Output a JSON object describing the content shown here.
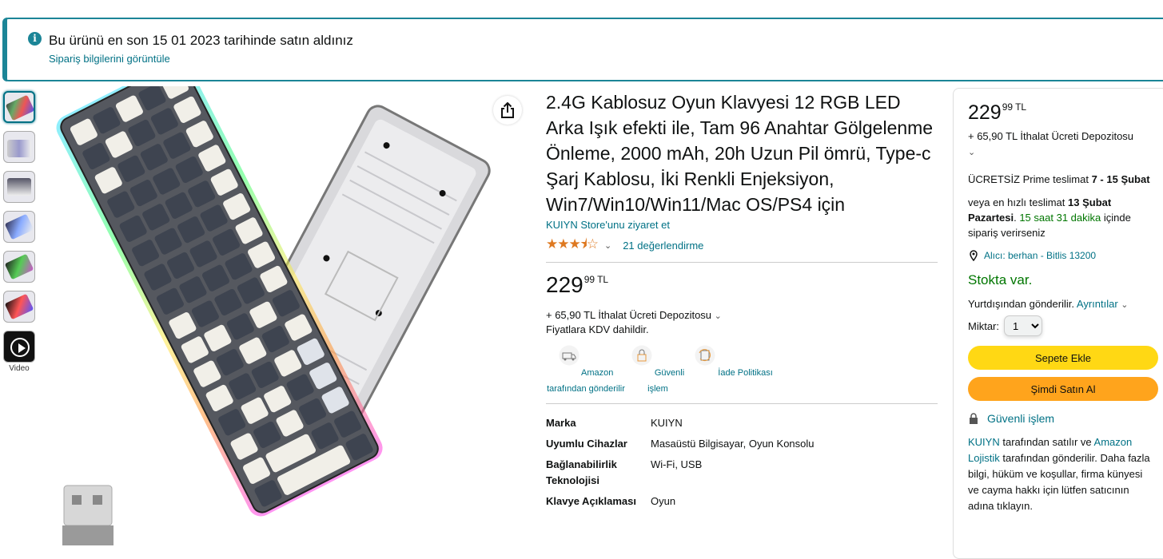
{
  "alert": {
    "message": "Bu ürünü en son 15 01 2023 tarihinde satın aldınız",
    "link": "Sipariş bilgilerini görüntüle"
  },
  "gallery": {
    "video_label": "Video"
  },
  "product": {
    "title": "2.4G Kablosuz Oyun Klavyesi 12 RGB LED Arka Işık efekti ile, Tam 96 Anahtar Gölgelenme Önleme, 2000 mAh, 20h Uzun Pil ömrü, Type-c Şarj Kablosu, İki Renkli Enjeksiyon, Win7/Win10/Win11/Mac OS/PS4 için",
    "store_link": "KUIYN Store'unu ziyaret et",
    "rating": 3.5,
    "rating_count": "21 değerlendirme",
    "price_whole": "229",
    "price_fraction": "99",
    "currency": "TL",
    "import_fee": "+ 65,90 TL İthalat Ücreti Depozitosu",
    "vat_note": "Fiyatlara KDV dahildir.",
    "features": [
      {
        "label": "Amazon tarafından gönderilir",
        "icon": "truck-icon"
      },
      {
        "label": "Güvenli işlem",
        "icon": "lock-icon"
      },
      {
        "label": "İade Politikası",
        "icon": "return-icon"
      }
    ],
    "specs": [
      {
        "key": "Marka",
        "value": "KUIYN"
      },
      {
        "key": "Uyumlu Cihazlar",
        "value": "Masaüstü Bilgisayar, Oyun Konsolu"
      },
      {
        "key": "Bağlanabilirlik Teknolojisi",
        "value": "Wi-Fi, USB"
      },
      {
        "key": "Klavye Açıklaması",
        "value": "Oyun"
      }
    ]
  },
  "buybox": {
    "price_whole": "229",
    "price_fraction": "99",
    "currency": "TL",
    "import_fee": "+ 65,90 TL İthalat Ücreti Depozitosu",
    "delivery_prefix": "ÜCRETSİZ Prime teslimat",
    "delivery_dates": "7 - 15 Şubat",
    "fast_prefix": "veya en hızlı teslimat",
    "fast_date": "13 Şubat Pazartesi",
    "countdown": "15 saat 31 dakika",
    "countdown_suffix": "içinde sipariş verirseniz",
    "location": "Alıcı: berhan - Bitlis 13200",
    "stock": "Stokta var.",
    "ships_from": "Yurtdışından gönderilir.",
    "details_link": "Ayrıntılar",
    "qty_label": "Miktar:",
    "qty_value": "1",
    "add_to_cart": "Sepete Ekle",
    "buy_now": "Şimdi Satın Al",
    "secure": "Güvenli işlem",
    "seller_name": "KUIYN",
    "seller_mid": "tarafından satılır ve",
    "fulfiller": "Amazon Lojistik",
    "seller_rest": "tarafından gönderilir. Daha fazla bilgi, hüküm ve koşullar, firma künyesi ve cayma hakkı için lütfen satıcının adına tıklayın."
  }
}
